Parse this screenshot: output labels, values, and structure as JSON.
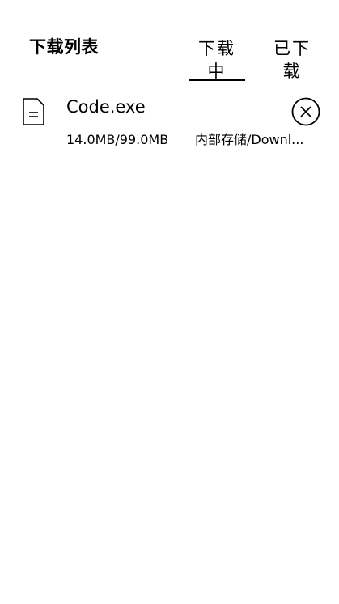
{
  "header": {
    "title": "下载列表",
    "tabs": [
      {
        "label": "下载中",
        "active": true
      },
      {
        "label": "已下载",
        "active": false
      }
    ]
  },
  "downloads": [
    {
      "file_icon": "document-icon",
      "name": "Code.exe",
      "size_progress": "14.0MB/99.0MB",
      "path": "内部存储/Downl...",
      "action_icon": "close-circle-icon"
    }
  ],
  "colors": {
    "text": "#000000",
    "divider": "#9e9e9e",
    "background": "#ffffff"
  }
}
